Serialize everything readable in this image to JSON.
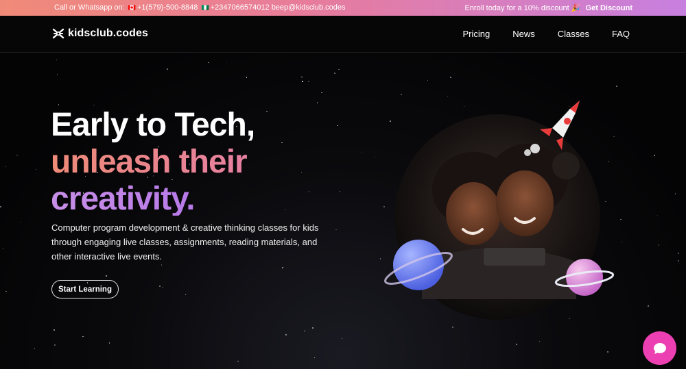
{
  "topbar": {
    "contact_label": "Call or Whatsapp on:",
    "phone_ca": "+1(579)-500-8848",
    "phone_ng": "+2347066574012",
    "email": "beep@kidsclub.codes",
    "promo_text": "Enroll today for a 10% discount",
    "promo_icon": "🎉",
    "promo_link": "Get Discount"
  },
  "nav": {
    "logo_text": "kidsclub.codes",
    "items": [
      "Pricing",
      "News",
      "Classes",
      "FAQ"
    ]
  },
  "hero": {
    "line1": "Early to Tech,",
    "line2": "unleash their",
    "line3": "creativity.",
    "description": "Computer program development & creative thinking classes for kids through engaging live classes, assignments, reading materials, and other interactive live events.",
    "cta_label": "Start Learning"
  },
  "colors": {
    "gradient_start": "#f08a78",
    "gradient_end": "#c77fe0",
    "chat_button": "#ec3fb1"
  }
}
